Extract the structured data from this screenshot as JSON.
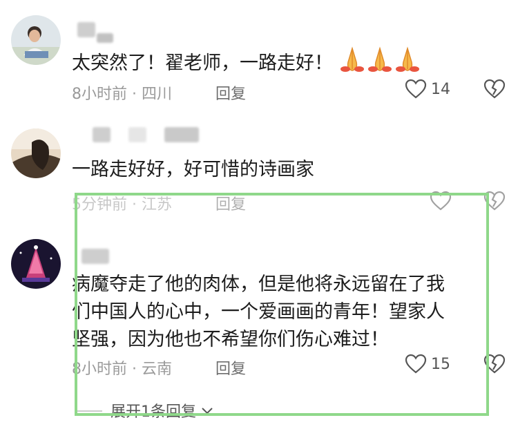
{
  "comments": [
    {
      "text": "太突然了！翟老师，一路走好！",
      "time_location": "8小时前 · 四川",
      "reply_label": "回复",
      "likes": "14",
      "emoji": "praying-hands-icon"
    },
    {
      "text": "一路走好好，好可惜的诗画家",
      "time_location": "5分钟前 · 江苏",
      "reply_label": "回复",
      "likes": ""
    },
    {
      "text_lines": [
        "病魔夺走了他的肉体，但是他将永远留在了我",
        "们中国人的心中，一个爱画画的青年！望家人",
        "坚强，因为他也不希望你们伤心难过！"
      ],
      "time_location": "8小时前 · 云南",
      "reply_label": "回复",
      "likes": "15"
    }
  ],
  "expand_replies_label": "展开1条回复",
  "colors": {
    "highlight": "#8fd88a",
    "meta_text": "#9a9a9a",
    "body_text": "#1c1c1c"
  }
}
